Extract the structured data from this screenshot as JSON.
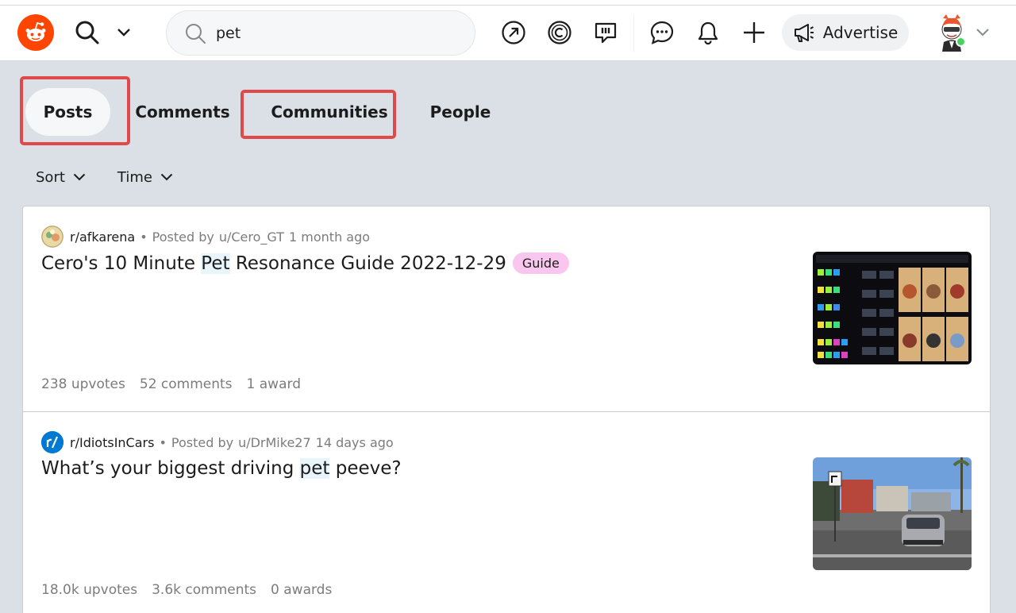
{
  "header": {
    "search": {
      "value": "pet"
    },
    "advertise_label": "Advertise",
    "icons": {
      "logo": "reddit-logo",
      "search": "search-icon",
      "popular": "trending-arrow-icon",
      "coins": "coins-icon",
      "chat_feedback": "speech-bubble-icon",
      "chat": "chat-icon",
      "notifications": "bell-icon",
      "create": "plus-icon",
      "advertise": "megaphone-icon"
    }
  },
  "tabs": [
    {
      "label": "Posts",
      "active": true
    },
    {
      "label": "Comments",
      "active": false
    },
    {
      "label": "Communities",
      "active": false
    },
    {
      "label": "People",
      "active": false
    }
  ],
  "filters": {
    "sort_label": "Sort",
    "time_label": "Time"
  },
  "posts": [
    {
      "subreddit": "r/afkarena",
      "posted_by_label": "Posted by",
      "author": "u/Cero_GT",
      "time": "1 month ago",
      "title_before": "Cero's 10 Minute ",
      "title_match": "Pet",
      "title_after": " Resonance Guide 2022-12-29",
      "flair": "Guide",
      "upvotes": "238 upvotes",
      "comments": "52 comments",
      "awards": "1 award"
    },
    {
      "subreddit": "r/IdiotsInCars",
      "posted_by_label": "Posted by",
      "author": "u/DrMike27",
      "time": "14 days ago",
      "title_before": "What’s your biggest driving ",
      "title_match": "pet",
      "title_after": " peeve?",
      "upvotes": "18.0k upvotes",
      "comments": "3.6k comments",
      "awards": "0 awards"
    }
  ],
  "colors": {
    "brand": "#ff4500",
    "page_bg": "#dae0e6",
    "highlight_box": "#e0484a",
    "flair_bg": "#f8c6ef",
    "online": "#46d160"
  }
}
